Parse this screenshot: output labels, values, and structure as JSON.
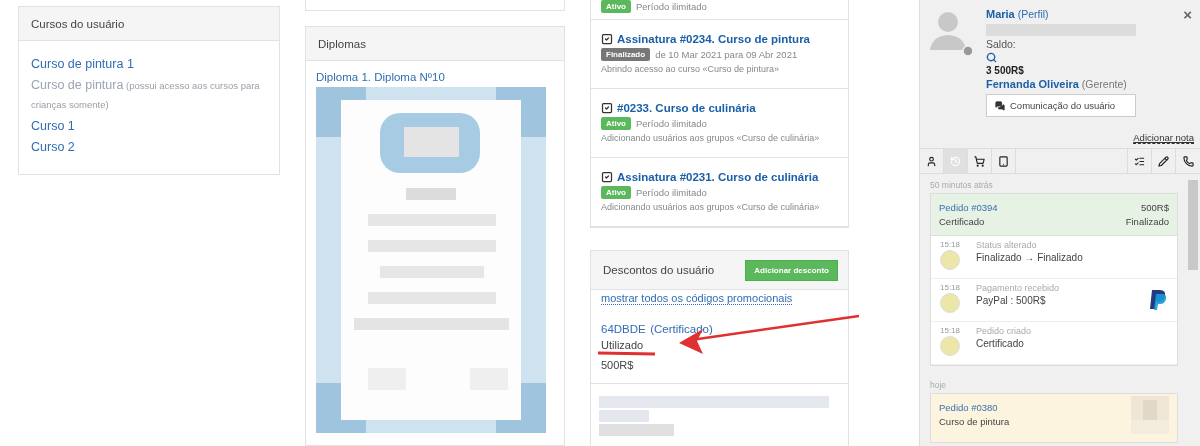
{
  "courses_card": {
    "title": "Cursos do usuário",
    "items": [
      {
        "label": "Curso de pintura 1",
        "disabled": false
      },
      {
        "label": "Curso de pintura",
        "note": "(possui acesso aos cursos para crianças somente)",
        "disabled": true
      },
      {
        "label": "Curso 1",
        "disabled": false
      },
      {
        "label": "Curso 2",
        "disabled": false
      }
    ]
  },
  "diplomas": {
    "title": "Diplomas",
    "link": "Diploma 1. Diploma Nº10"
  },
  "subscriptions": [
    {
      "kind": "active",
      "badge": "Ativo",
      "period": "Período ilimitado"
    },
    {
      "title": "Assinatura #0234. Curso de pintura",
      "kind": "finished",
      "badge": "Finalizado",
      "period": "de 10 Mar 2021 para 09 Abr 2021",
      "description": "Abrindo acesso ao curso «Curso de pintura»"
    },
    {
      "title": "#0233. Curso de culinária",
      "kind": "active",
      "badge": "Ativo",
      "period": "Período ilimitado",
      "description": "Adicionando usuários aos grupos «Curso de culinária»"
    },
    {
      "title": "Assinatura #0231. Curso de culinária",
      "kind": "active",
      "badge": "Ativo",
      "period": "Período ilimitado",
      "description": "Adicionando usuários aos grupos «Curso de culinária»"
    }
  ],
  "discounts": {
    "title": "Descontos do usuário",
    "button": "Adicionar desconto",
    "show_all": "mostrar todos os códigos promocionais",
    "code": "64DBDE",
    "code_note": "(Certificado)",
    "status": "Utilizado",
    "amount": "500R$"
  },
  "profile": {
    "name": "Maria",
    "profile_link": "(Perfil)",
    "balance_label": "Saldo:",
    "balance": "3 500R$",
    "manager": "Fernanda Oliveira",
    "manager_role": "(Gerente)",
    "message_button": "Comunicação do usuário",
    "add_note": "Adicionar nota",
    "close": "×"
  },
  "tabs": [
    {
      "kind": "user",
      "selected": false
    },
    {
      "kind": "history",
      "selected": true
    },
    {
      "kind": "cart",
      "selected": false
    },
    {
      "kind": "tablet",
      "selected": false
    },
    {
      "kind": "check",
      "selected": false
    },
    {
      "kind": "pencil",
      "selected": false
    },
    {
      "kind": "phone",
      "selected": false
    }
  ],
  "timeline": [
    {
      "time_label": "50 minutos atrás",
      "order": {
        "kind": "finished",
        "title": "Pedido #0394",
        "amount": "500R$",
        "product": "Certificado",
        "state": "Finalizado"
      },
      "events": [
        {
          "kind": "plain",
          "time": "15:18",
          "title": "Status alterado",
          "detail": "Finalizado → Finalizado"
        },
        {
          "kind": "payment",
          "time": "15:18",
          "title": "Pagamento recebido",
          "detail": "PayPal : 500R$"
        },
        {
          "kind": "plain",
          "time": "15:18",
          "title": "Pedido criado",
          "detail": "Certificado"
        }
      ]
    },
    {
      "time_label": "hoje",
      "order": {
        "kind": "pending",
        "title": "Pedido #0380",
        "product": "Curso de pintura"
      }
    }
  ]
}
